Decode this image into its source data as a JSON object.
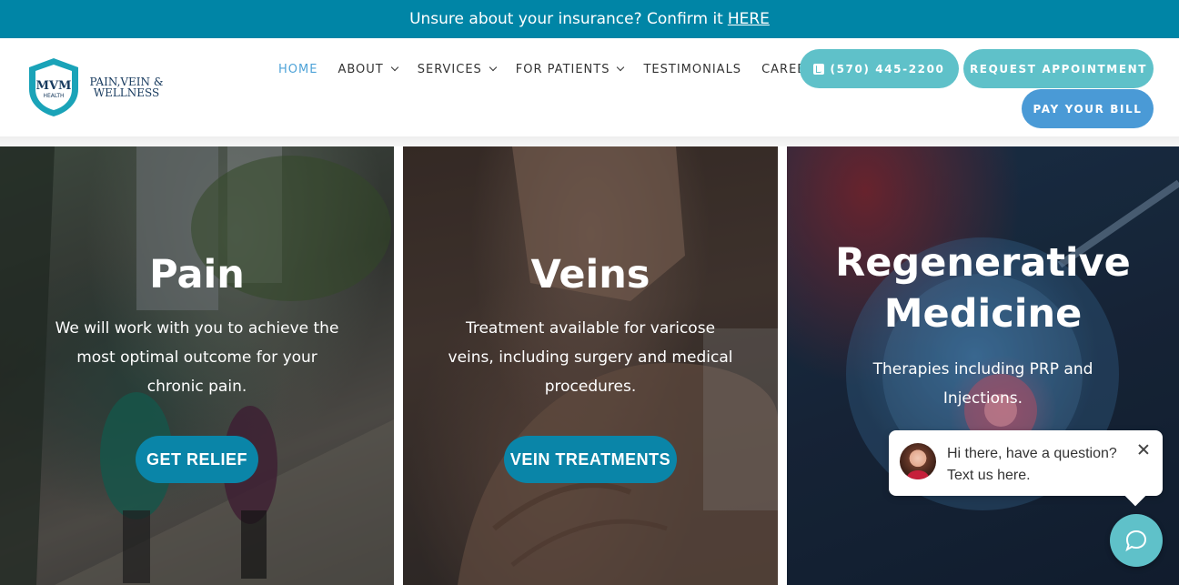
{
  "banner": {
    "text": "Unsure about your insurance? Confirm it",
    "link": "HERE"
  },
  "logo": {
    "mark": "MVM",
    "sub": "HEALTH",
    "name_line1": "PAIN,VEIN &",
    "name_line2": "WELLNESS"
  },
  "nav": {
    "items": [
      {
        "label": "HOME",
        "active": true,
        "dropdown": false
      },
      {
        "label": "ABOUT",
        "active": false,
        "dropdown": true
      },
      {
        "label": "SERVICES",
        "active": false,
        "dropdown": true
      },
      {
        "label": "FOR PATIENTS",
        "active": false,
        "dropdown": true
      },
      {
        "label": "TESTIMONIALS",
        "active": false,
        "dropdown": false
      },
      {
        "label": "CAREERS",
        "active": false,
        "dropdown": false
      }
    ],
    "phone": "(570) 445-2200",
    "request": "REQUEST APPOINTMENT",
    "pay": "PAY YOUR BILL"
  },
  "panels": [
    {
      "title": "Pain",
      "desc_lines": [
        "We will work with you to achieve the",
        "most optimal outcome for your",
        "chronic pain."
      ],
      "button": "GET RELIEF"
    },
    {
      "title": "Veins",
      "desc_lines": [
        "Treatment available for varicose",
        "veins, including surgery and medical",
        "procedures."
      ],
      "button": "VEIN TREATMENTS"
    },
    {
      "title_lines": [
        "Regenerative",
        "Medicine"
      ],
      "desc_lines": [
        "Therapies including PRP and",
        "Injections."
      ]
    }
  ],
  "chat": {
    "line1": "Hi there, have a question?",
    "line2": "Text us here."
  },
  "colors": {
    "banner": "#0085a6",
    "accent_teal": "#5fc1c9",
    "pay_blue": "#4a9ad6",
    "cta_blue": "#0a85a8",
    "nav_active": "#4ea3d8"
  }
}
